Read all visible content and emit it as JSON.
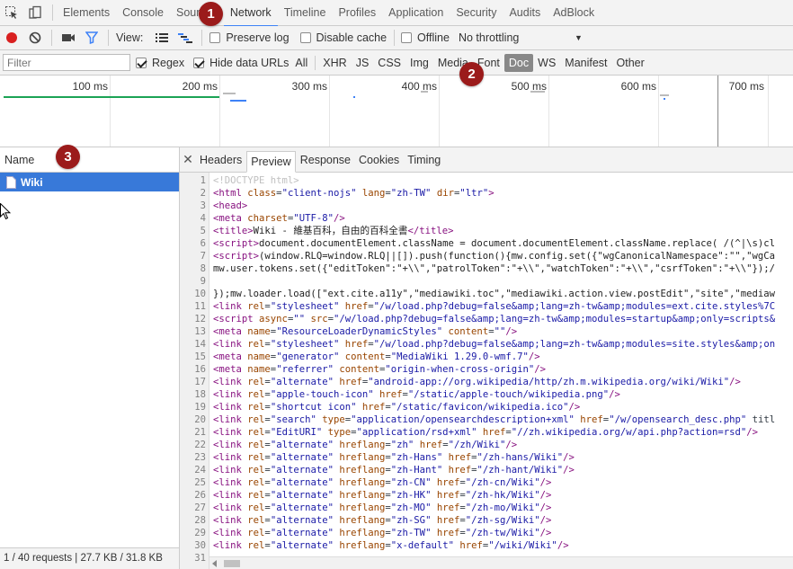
{
  "tabbar": {
    "tabs": [
      "Elements",
      "Console",
      "Sources",
      "Network",
      "Timeline",
      "Profiles",
      "Application",
      "Security",
      "Audits",
      "AdBlock"
    ],
    "active": "Network"
  },
  "toolbar": {
    "view_label": "View:",
    "preserve_log": "Preserve log",
    "disable_cache": "Disable cache",
    "offline": "Offline",
    "throttling": "No throttling"
  },
  "filterbar": {
    "placeholder": "Filter",
    "regex": "Regex",
    "hide_data_urls": "Hide data URLs",
    "types": [
      "All",
      "XHR",
      "JS",
      "CSS",
      "Img",
      "Media",
      "Font",
      "Doc",
      "WS",
      "Manifest",
      "Other"
    ],
    "active_type": "Doc"
  },
  "overview": {
    "ticks": [
      "100 ms",
      "200 ms",
      "300 ms",
      "400 ms",
      "500 ms",
      "600 ms",
      "700 ms"
    ]
  },
  "requests": {
    "name_header": "Name",
    "selected": "Wiki",
    "status": "1 / 40 requests  |  27.7 KB / 31.8 KB"
  },
  "details": {
    "tabs": [
      "Headers",
      "Preview",
      "Response",
      "Cookies",
      "Timing"
    ],
    "active": "Preview"
  },
  "badges": [
    "1",
    "2",
    "3"
  ],
  "code_lines": [
    "<!DOCTYPE html>",
    "<html class=\"client-nojs\" lang=\"zh-TW\" dir=\"ltr\">",
    "<head>",
    "<meta charset=\"UTF-8\"/>",
    "<title>Wiki - 維基百科，自由的百科全書</title>",
    "<script>document.documentElement.className = document.documentElement.className.replace( /(^|\\s)cl",
    "<script>(window.RLQ=window.RLQ||[]).push(function(){mw.config.set({\"wgCanonicalNamespace\":\"\",\"wgCa",
    "mw.user.tokens.set({\"editToken\":\"+\\\\\",\"patrolToken\":\"+\\\\\",\"watchToken\":\"+\\\\\",\"csrfToken\":\"+\\\\\"});/",
    "",
    "});mw.loader.load([\"ext.cite.a11y\",\"mediawiki.toc\",\"mediawiki.action.view.postEdit\",\"site\",\"mediaw",
    "<link rel=\"stylesheet\" href=\"/w/load.php?debug=false&amp;lang=zh-tw&amp;modules=ext.cite.styles%7C",
    "<script async=\"\" src=\"/w/load.php?debug=false&amp;lang=zh-tw&amp;modules=startup&amp;only=scripts&",
    "<meta name=\"ResourceLoaderDynamicStyles\" content=\"\"/>",
    "<link rel=\"stylesheet\" href=\"/w/load.php?debug=false&amp;lang=zh-tw&amp;modules=site.styles&amp;on",
    "<meta name=\"generator\" content=\"MediaWiki 1.29.0-wmf.7\"/>",
    "<meta name=\"referrer\" content=\"origin-when-cross-origin\"/>",
    "<link rel=\"alternate\" href=\"android-app://org.wikipedia/http/zh.m.wikipedia.org/wiki/Wiki\"/>",
    "<link rel=\"apple-touch-icon\" href=\"/static/apple-touch/wikipedia.png\"/>",
    "<link rel=\"shortcut icon\" href=\"/static/favicon/wikipedia.ico\"/>",
    "<link rel=\"search\" type=\"application/opensearchdescription+xml\" href=\"/w/opensearch_desc.php\" titl",
    "<link rel=\"EditURI\" type=\"application/rsd+xml\" href=\"//zh.wikipedia.org/w/api.php?action=rsd\"/>",
    "<link rel=\"alternate\" hreflang=\"zh\" href=\"/zh/Wiki\"/>",
    "<link rel=\"alternate\" hreflang=\"zh-Hans\" href=\"/zh-hans/Wiki\"/>",
    "<link rel=\"alternate\" hreflang=\"zh-Hant\" href=\"/zh-hant/Wiki\"/>",
    "<link rel=\"alternate\" hreflang=\"zh-CN\" href=\"/zh-cn/Wiki\"/>",
    "<link rel=\"alternate\" hreflang=\"zh-HK\" href=\"/zh-hk/Wiki\"/>",
    "<link rel=\"alternate\" hreflang=\"zh-MO\" href=\"/zh-mo/Wiki\"/>",
    "<link rel=\"alternate\" hreflang=\"zh-SG\" href=\"/zh-sg/Wiki\"/>",
    "<link rel=\"alternate\" hreflang=\"zh-TW\" href=\"/zh-tw/Wiki\"/>",
    "<link rel=\"alternate\" hreflang=\"x-default\" href=\"/wiki/Wiki\"/>",
    ""
  ],
  "colors": {
    "accent": "#3e82f7",
    "selection": "#3879d9",
    "badge": "#9b1b1b",
    "record": "#d92020"
  }
}
